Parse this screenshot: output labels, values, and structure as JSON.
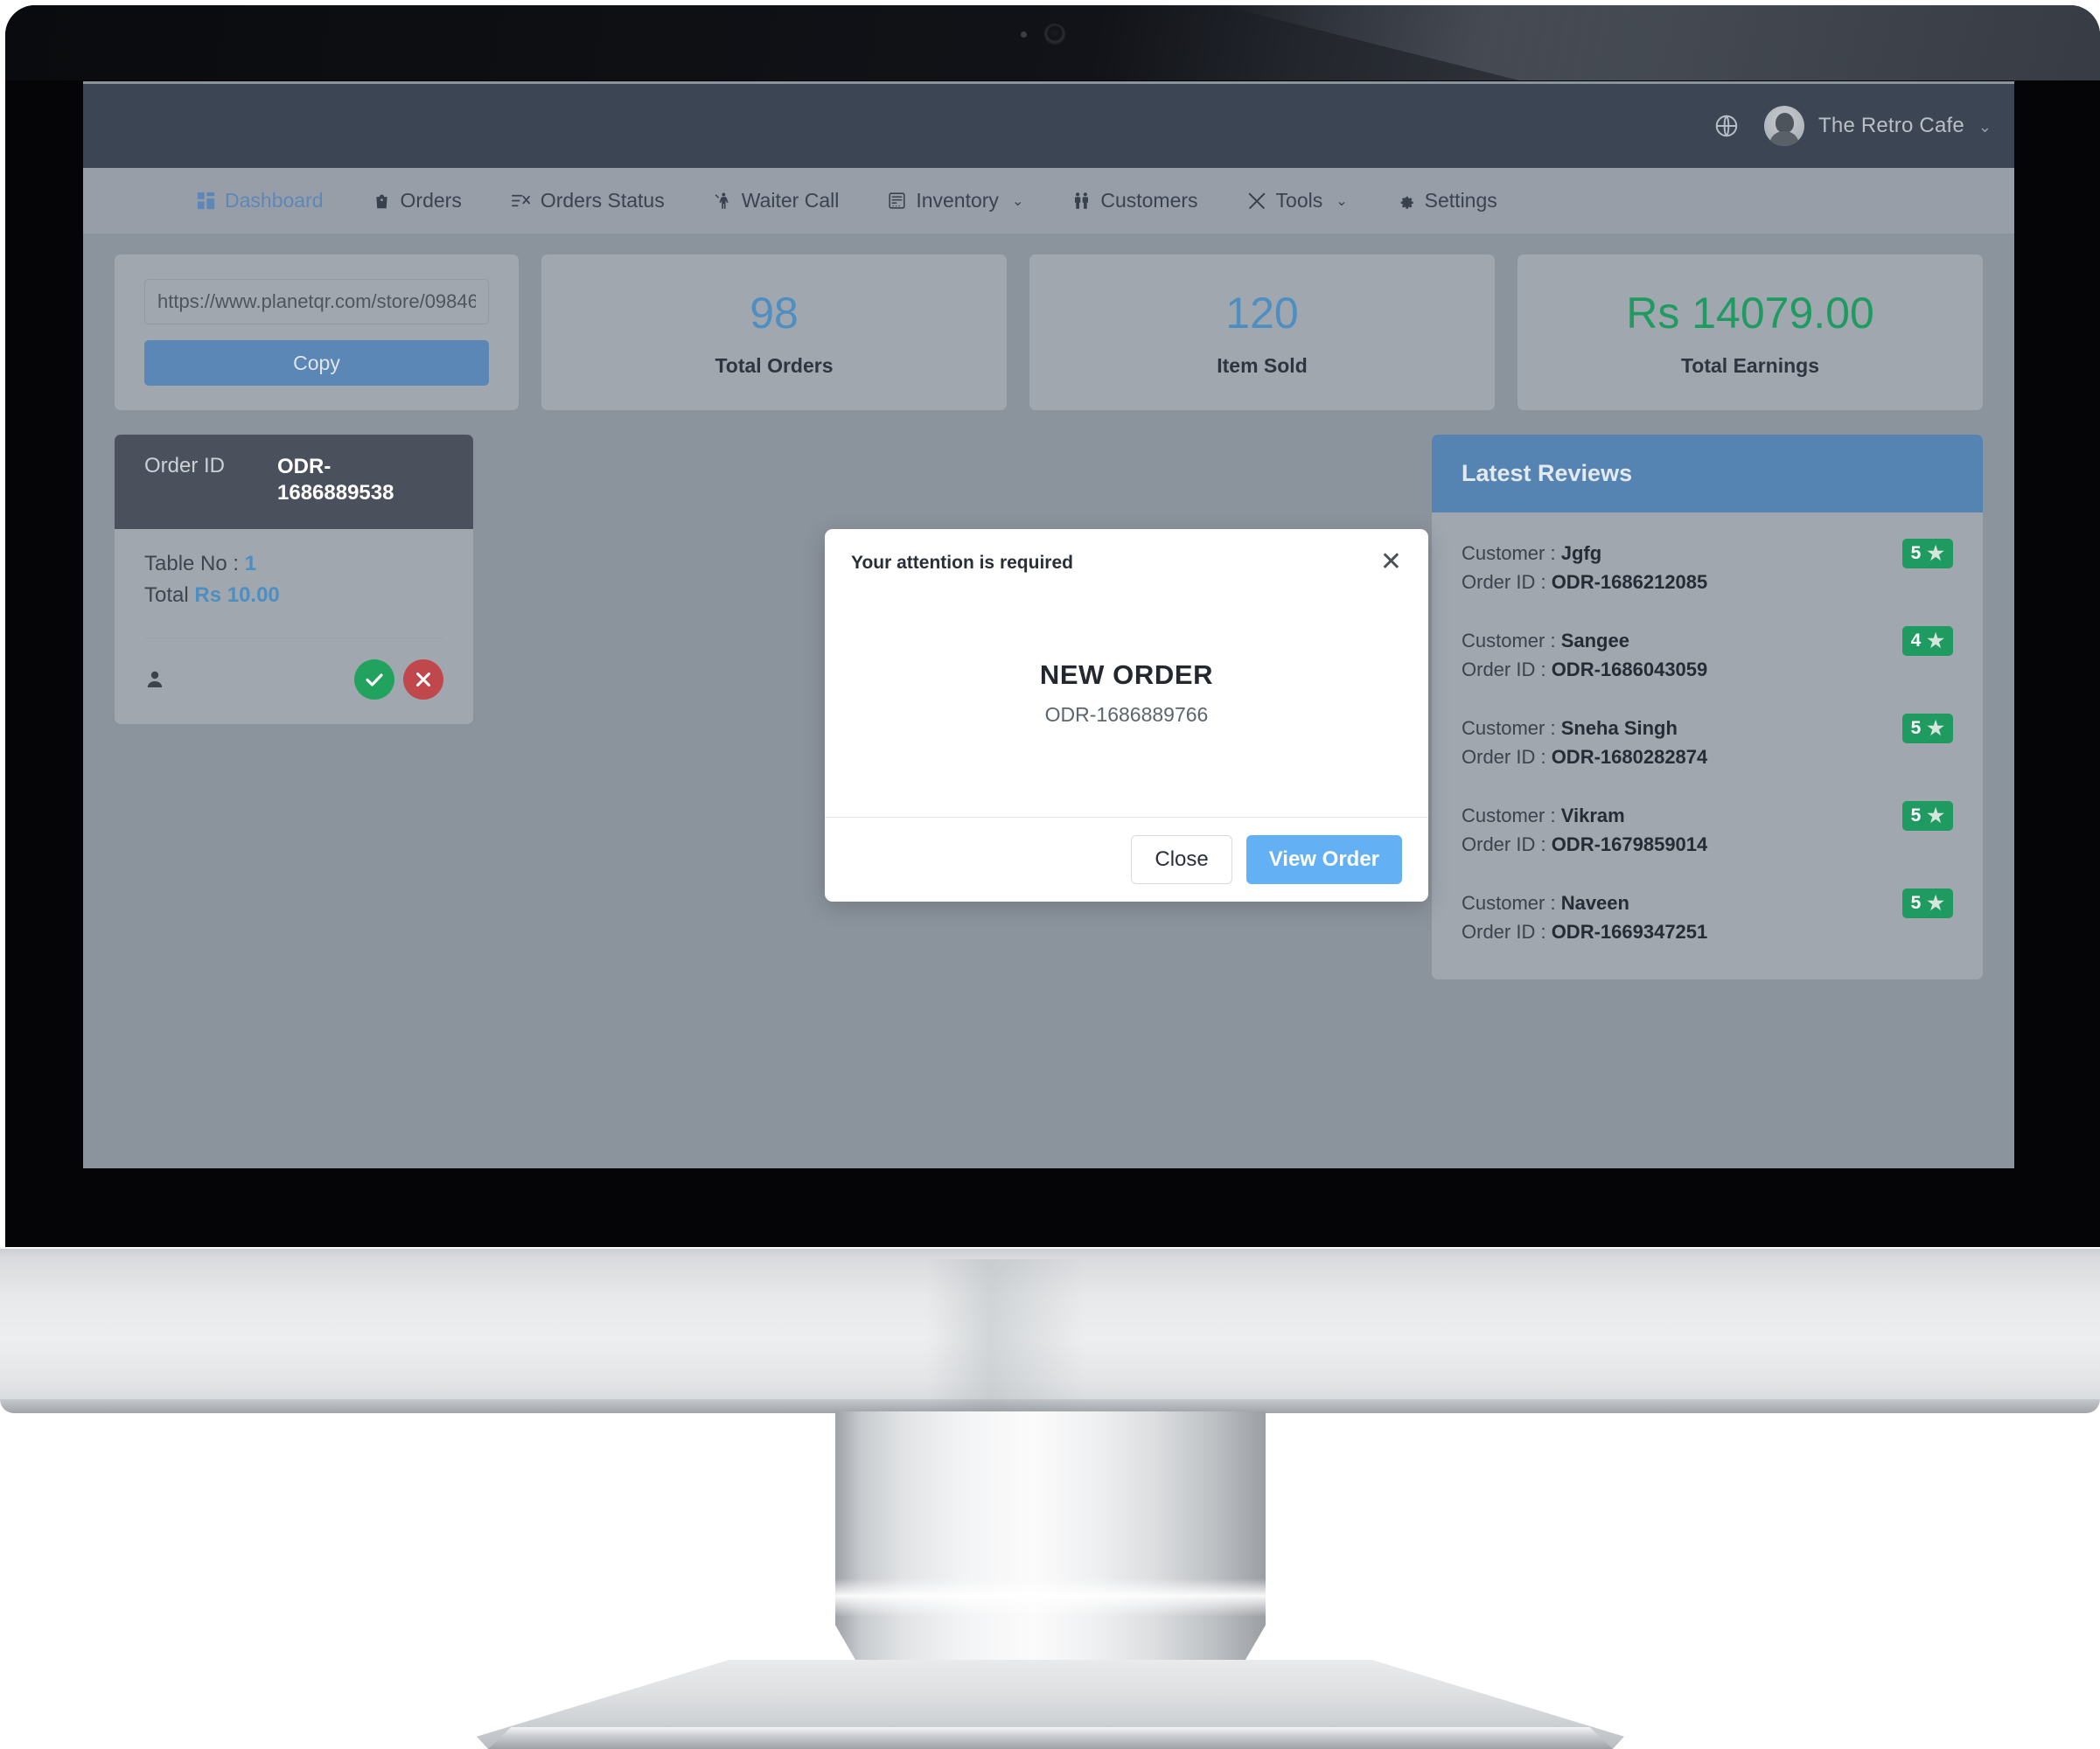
{
  "header": {
    "globe_icon": "globe-icon",
    "user_name": "The Retro Cafe",
    "caret": "⌄",
    "avatar_icon": "avatar"
  },
  "nav": {
    "items": [
      {
        "label": "Dashboard",
        "icon": "grid-icon",
        "active": true,
        "caret": ""
      },
      {
        "label": "Orders",
        "icon": "bag-icon",
        "active": false,
        "caret": ""
      },
      {
        "label": "Orders Status",
        "icon": "list-check-icon",
        "active": false,
        "caret": ""
      },
      {
        "label": "Waiter Call",
        "icon": "waiter-icon",
        "active": false,
        "caret": ""
      },
      {
        "label": "Inventory",
        "icon": "inventory-icon",
        "active": false,
        "caret": "⌄"
      },
      {
        "label": "Customers",
        "icon": "customers-icon",
        "active": false,
        "caret": ""
      },
      {
        "label": "Tools",
        "icon": "tools-icon",
        "active": false,
        "caret": "⌄"
      },
      {
        "label": "Settings",
        "icon": "gear-icon",
        "active": false,
        "caret": ""
      }
    ]
  },
  "store_link_card": {
    "url_value": "https://www.planetqr.com/store/09846",
    "url_placeholder": "https://www.planetqr.com/store/09846",
    "copy_label": "Copy"
  },
  "stats": [
    {
      "value": "98",
      "label": "Total Orders",
      "color": "#4e8ec0"
    },
    {
      "value": "120",
      "label": "Item Sold",
      "color": "#4e8ec0"
    },
    {
      "value": "Rs 14079.00",
      "label": "Total Earnings",
      "color": "#1f9b62"
    }
  ],
  "order_card": {
    "head_label": "Order ID",
    "head_value": "ODR-1686889538",
    "table_label": "Table No : ",
    "table_value": "1",
    "total_label": "Total ",
    "total_value": "Rs 10.00",
    "person_icon": "person-icon",
    "accept_icon": "check-circle-icon",
    "reject_icon": "x-circle-icon"
  },
  "reviews": {
    "title": "Latest Reviews",
    "customer_prefix": "Customer : ",
    "order_prefix": "Order ID : ",
    "items": [
      {
        "customer": "Jgfg",
        "order_id": "ODR-1686212085",
        "rating": "5"
      },
      {
        "customer": "Sangee",
        "order_id": "ODR-1686043059",
        "rating": "4"
      },
      {
        "customer": "Sneha Singh",
        "order_id": "ODR-1680282874",
        "rating": "5"
      },
      {
        "customer": "Vikram",
        "order_id": "ODR-1679859014",
        "rating": "5"
      },
      {
        "customer": "Naveen",
        "order_id": "ODR-1669347251",
        "rating": "5"
      }
    ],
    "star_glyph": "★"
  },
  "modal": {
    "title": "Your attention is required",
    "close_icon": "✕",
    "heading": "NEW ORDER",
    "order_id": "ODR-1686889766",
    "close_label": "Close",
    "view_label": "View Order"
  },
  "colors": {
    "accent_blue": "#5a87b5",
    "primary_button": "#63b0f5",
    "success_green": "#1f9b62",
    "danger_red": "#c0474b",
    "header_dark": "#3c4553",
    "nav_bg": "#979ea7"
  }
}
